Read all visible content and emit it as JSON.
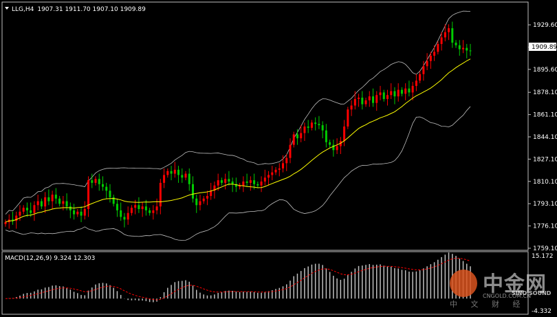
{
  "header": {
    "symbol": "LLG,H4",
    "ohlc": "1907.31 1911.70 1907.10 1909.89"
  },
  "price_axis": {
    "ticks": [
      "1929.60",
      "1912.60",
      "1895.60",
      "1878.10",
      "1861.10",
      "1844.10",
      "1827.10",
      "1810.10",
      "1793.10",
      "1776.10",
      "1759.10"
    ],
    "current_price": "1909.89"
  },
  "macd_panel": {
    "label": "MACD(12,26,9) 9.324 12.303",
    "top_value": "15.172",
    "bottom_value": "-4.332"
  },
  "watermark": {
    "main": "中金网",
    "sub": "CNGOLD.COM.CN",
    "bottom": "中 文 财 经",
    "brand": "SINO SOUND"
  },
  "colors": {
    "background": "#000000",
    "bull": "#ff0000",
    "bear": "#00cc00",
    "ma": "#ffff00",
    "bands": "#c0c0c0",
    "signal": "#ff0000",
    "histogram": "#c0c0c0"
  },
  "chart_data": {
    "type": "candlestick",
    "price_range": [
      1759.1,
      1937.0
    ],
    "closes": [
      1779,
      1781,
      1780,
      1784,
      1787,
      1790,
      1788,
      1786,
      1792,
      1795,
      1791,
      1798,
      1795,
      1800,
      1797,
      1793,
      1795,
      1791,
      1788,
      1785,
      1787,
      1784,
      1789,
      1811,
      1809,
      1812,
      1808,
      1806,
      1803,
      1798,
      1793,
      1788,
      1783,
      1781,
      1786,
      1790,
      1792,
      1789,
      1791,
      1788,
      1786,
      1788,
      1791,
      1809,
      1815,
      1818,
      1816,
      1819,
      1815,
      1813,
      1816,
      1808,
      1797,
      1792,
      1795,
      1797,
      1799,
      1803,
      1807,
      1811,
      1809,
      1812,
      1810,
      1808,
      1806,
      1807,
      1810,
      1809,
      1811,
      1808,
      1807,
      1810,
      1813,
      1815,
      1817,
      1819,
      1820,
      1824,
      1828,
      1838,
      1846,
      1843,
      1847,
      1852,
      1851,
      1855,
      1854,
      1853,
      1849,
      1840,
      1838,
      1834,
      1837,
      1841,
      1852,
      1865,
      1868,
      1873,
      1874,
      1869,
      1872,
      1875,
      1870,
      1876,
      1878,
      1873,
      1876,
      1879,
      1875,
      1880,
      1877,
      1881,
      1878,
      1883,
      1887,
      1892,
      1898,
      1902,
      1906,
      1909,
      1915,
      1920,
      1924,
      1927,
      1916,
      1914,
      1911,
      1912,
      1910,
      1909.89
    ],
    "macd_histogram_range": [
      -4.332,
      15.172
    ],
    "macd_labels": {
      "macd": 9.324,
      "signal": 12.303
    }
  }
}
